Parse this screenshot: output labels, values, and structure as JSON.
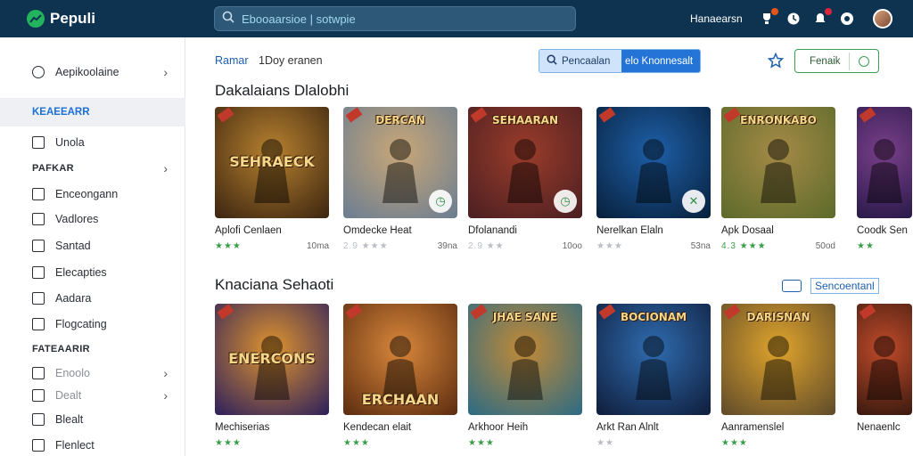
{
  "app": {
    "name": "Pepuli"
  },
  "search": {
    "value": "Ebooaarsioe | sotwpie"
  },
  "top": {
    "user": "Hanaearsn"
  },
  "sidebar": {
    "items": [
      {
        "label": "Aepikoolaine",
        "kind": "item",
        "chevron": "›"
      },
      {
        "label": "KEAEEARR",
        "kind": "head-active"
      },
      {
        "label": "Unola",
        "kind": "item"
      },
      {
        "label": "PAFKAR",
        "kind": "head",
        "chevron": "›"
      },
      {
        "label": "Enceongann",
        "kind": "item"
      },
      {
        "label": "Vadlores",
        "kind": "item"
      },
      {
        "label": "Santad",
        "kind": "item"
      },
      {
        "label": "Elecapties",
        "kind": "item"
      },
      {
        "label": "Aadara",
        "kind": "item"
      },
      {
        "label": "Flogcating",
        "kind": "item"
      },
      {
        "label": "FATEAARIR",
        "kind": "head"
      },
      {
        "label": "Enoolo",
        "kind": "item",
        "chevron": "›"
      },
      {
        "label": "Dealt",
        "kind": "item",
        "chevron": "›"
      },
      {
        "label": "Blealt",
        "kind": "item"
      },
      {
        "label": "Flenlect",
        "kind": "item"
      }
    ]
  },
  "main": {
    "crumb_a": "Ramar",
    "crumb_b": "1Doy eranen",
    "search_button_left": "Pencaalan",
    "search_button_right": "elo Knonnesalt",
    "filter_label": "Fenaik",
    "section1_title": "Dakalaians Dlalobhi",
    "section2_title": "Knaciana Sehaoti",
    "see_all": "Sencoentanl"
  },
  "section1": [
    {
      "title": "Aplofi Cenlaen",
      "rating": "★★★",
      "count": "10ma",
      "art": "SEHRAECK",
      "colors": [
        "#3b2410",
        "#b8822f"
      ]
    },
    {
      "title": "Omdecke Heat",
      "rating": "2.9 ★★★",
      "count": "39na",
      "art": "DERCAN",
      "colors": [
        "#6a7d92",
        "#c9a777"
      ]
    },
    {
      "title": "Dfolanandi",
      "rating": "2.9 ★★",
      "count": "10oo",
      "art": "SEHAARAN",
      "colors": [
        "#4a1f22",
        "#9b3c2a"
      ]
    },
    {
      "title": "Nerelkan Elaln",
      "rating": "★★★",
      "count": "53na",
      "art": "",
      "colors": [
        "#07203b",
        "#1e5fa8"
      ]
    },
    {
      "title": "Apk Dosaal",
      "rating": "4.3 ★★★",
      "count": "50od",
      "art": "ENRONKABO",
      "colors": [
        "#5c6a2a",
        "#a58a47"
      ]
    },
    {
      "title": "Coodk Sen",
      "rating": "★★",
      "count": "",
      "art": "",
      "colors": [
        "#2a1a4a",
        "#7a3f8a"
      ]
    }
  ],
  "section2": [
    {
      "title": "Mechiserias",
      "rating": "★★★",
      "count": "",
      "art": "ENERCONS",
      "colors": [
        "#2c1f5c",
        "#e0942e"
      ]
    },
    {
      "title": "Kendecan elait",
      "rating": "★★★",
      "count": "",
      "art": "ERCHAAN",
      "colors": [
        "#5b2c0f",
        "#d9873b"
      ]
    },
    {
      "title": "Arkhoor Heih",
      "rating": "★★★",
      "count": "",
      "art": "JHAE SANE",
      "colors": [
        "#2b6b85",
        "#c48a35"
      ]
    },
    {
      "title": "Arkt Ran Alnlt",
      "rating": "★★",
      "count": "",
      "art": "BOCIONAM",
      "colors": [
        "#0f1d3b",
        "#2f6cb0"
      ]
    },
    {
      "title": "Aanramenslel",
      "rating": "★★★",
      "count": "",
      "art": "DARISNAN",
      "colors": [
        "#5e4a2a",
        "#e0a42c"
      ]
    },
    {
      "title": "Nenaenlc",
      "rating": "",
      "count": "",
      "art": "",
      "colors": [
        "#3a1a0f",
        "#c04a2a"
      ]
    }
  ],
  "colors": {
    "topbar": "#0e3350",
    "accent": "#2374d6",
    "green": "#3a9e48"
  },
  "icons": [
    "growth-logo-icon",
    "search-icon",
    "trophy-icon",
    "clock-icon",
    "notification-icon",
    "record-icon",
    "star-outline-icon",
    "filter-icon"
  ]
}
